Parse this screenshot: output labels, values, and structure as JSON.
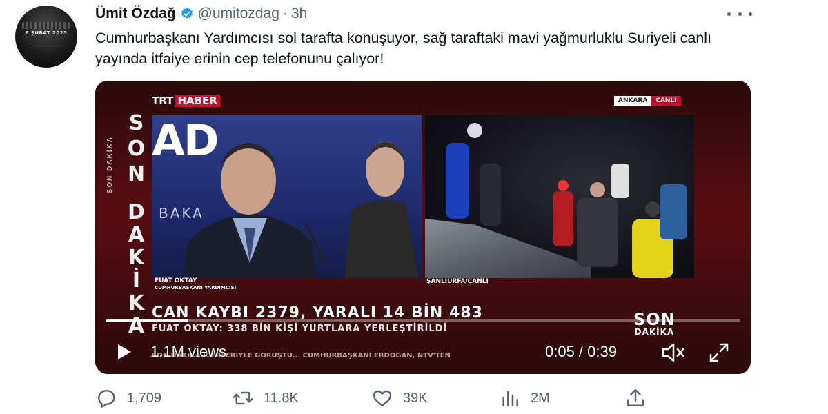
{
  "tweet": {
    "avatar_text": "6 ŞUBAT 2023",
    "display_name": "Ümit Özdağ",
    "handle": "@umitozdag",
    "separator": "·",
    "time": "3h",
    "text": "Cumhurbaşkanı Yardımcısı sol tarafta konuşuyor, sağ taraftaki mavi yağmurluklu Suriyeli canlı yayında itfaiye erinin cep telefonunu çalıyor!"
  },
  "video": {
    "son_vertical": "SON",
    "dakika_vertical": "DAKİKA",
    "son_dakika_small": "SON DAKİKA",
    "trt": "TRT",
    "haber": "HABER",
    "location_city": "ANKARA",
    "location_live": "CANLI",
    "banner_left": "AD",
    "bakan_text": "BAKA",
    "speaker_name": "FUAT OKTAY",
    "speaker_title": "CUMHURBAŞKANI YARDIMCISI",
    "right_caption": "ŞANLIURFA/CANLI",
    "headline": "CAN KAYBI 2379, YARALI 14 BİN 483",
    "subline": "FUAT OKTAY: 338 BİN KİŞİ YURTLARA YERLEŞTİRİLDİ",
    "son_logo_1": "SON",
    "son_logo_2": "DAKİKA",
    "ticker": "SON DAKİKA  İDERLERİYLE GÖRÜŞTÜ... CUMHURBAŞKANI ERDOĞAN, NTV'TEN",
    "views": "1.1M views",
    "timecode": "0:05 / 0:39",
    "progress": 0.128
  },
  "actions": {
    "replies": "1,709",
    "retweets": "11.8K",
    "likes": "39K",
    "views": "2M"
  },
  "colors": {
    "verified": "#1d9bf0",
    "muted": "#536471",
    "trt_red": "#c8102e"
  }
}
